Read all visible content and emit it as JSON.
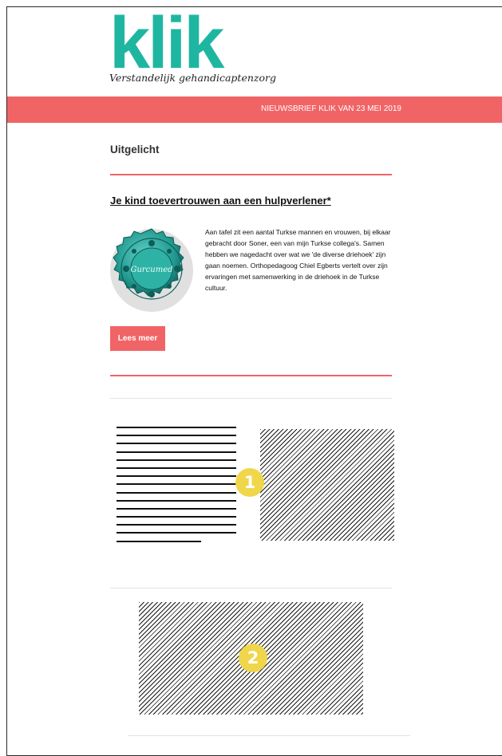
{
  "brand": {
    "logo_text": "klik",
    "tagline": "Verstandelijk gehandicaptenzorg",
    "accent_color": "#f16466",
    "logo_color": "#1fb6a1"
  },
  "banner": {
    "text": "NIEUWSBRIEF KLIK VAN 23 MEI 2019"
  },
  "section": {
    "title": "Uitgelicht"
  },
  "article": {
    "title": "Je kind toevertrouwen aan een hulpverlener*",
    "image_icon": "decorative-plate-icon",
    "plate_text": "Gurcumed",
    "body": "Aan tafel zit een aantal Turkse mannen en vrouwen, bij elkaar gebracht door Soner, een van mijn Turkse collega's. Samen hebben we nagedacht over wat we 'de diverse driehoek' zijn gaan noemen. Orthopedagoog Chiel Egberts vertelt over zijn ervaringen met samenwerking in de driehoek in de Turkse cultuur.",
    "button_label": "Lees meer"
  },
  "placeholders": {
    "badge_1": "1",
    "badge_2": "2"
  }
}
